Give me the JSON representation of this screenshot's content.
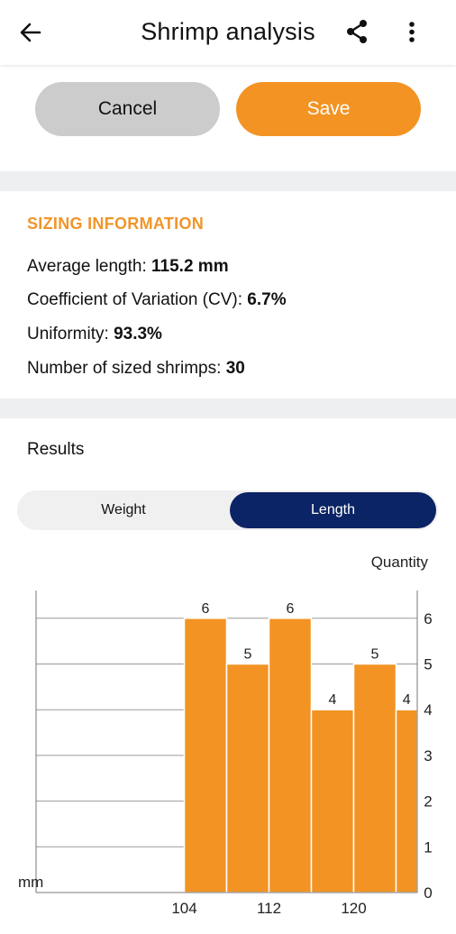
{
  "header": {
    "title": "Shrimp analysis",
    "back_icon": "arrow-left-icon",
    "share_icon": "share-icon",
    "more_icon": "more-vert-icon"
  },
  "actions": {
    "cancel_label": "Cancel",
    "save_label": "Save"
  },
  "sizing": {
    "title": "SIZING INFORMATION",
    "average_label": "Average length:",
    "average_value": "115.2 mm",
    "cv_label": "Coefficient of Variation (CV):",
    "cv_value": "6.7%",
    "uniformity_label": "Uniformity:",
    "uniformity_value": "93.3%",
    "count_label": "Number of sized shrimps:",
    "count_value": "30"
  },
  "results": {
    "title": "Results",
    "tabs": [
      {
        "label": "Weight",
        "selected": false
      },
      {
        "label": "Length",
        "selected": true
      }
    ]
  },
  "colors": {
    "accent": "#f39323",
    "section_title": "#f0952a",
    "selected_tab": "#0b2465",
    "cancel_bg": "#cccccc"
  },
  "chart_data": {
    "type": "bar",
    "xlabel": "mm",
    "ylabel": "Quantity",
    "bin_width": 4,
    "xlim": [
      90,
      126
    ],
    "xticks": [
      104,
      112,
      120
    ],
    "ylim": [
      0,
      6.6
    ],
    "yticks": [
      0,
      1,
      2,
      3,
      4,
      5,
      6
    ],
    "bins": [
      {
        "start": 104,
        "end": 108,
        "value": 6
      },
      {
        "start": 108,
        "end": 112,
        "value": 5
      },
      {
        "start": 112,
        "end": 116,
        "value": 6
      },
      {
        "start": 116,
        "end": 120,
        "value": 4
      },
      {
        "start": 120,
        "end": 124,
        "value": 5
      },
      {
        "start": 124,
        "end": 128,
        "value": 4
      }
    ],
    "grid": true,
    "y_axis_side": "right",
    "bar_color": "#f39323"
  }
}
